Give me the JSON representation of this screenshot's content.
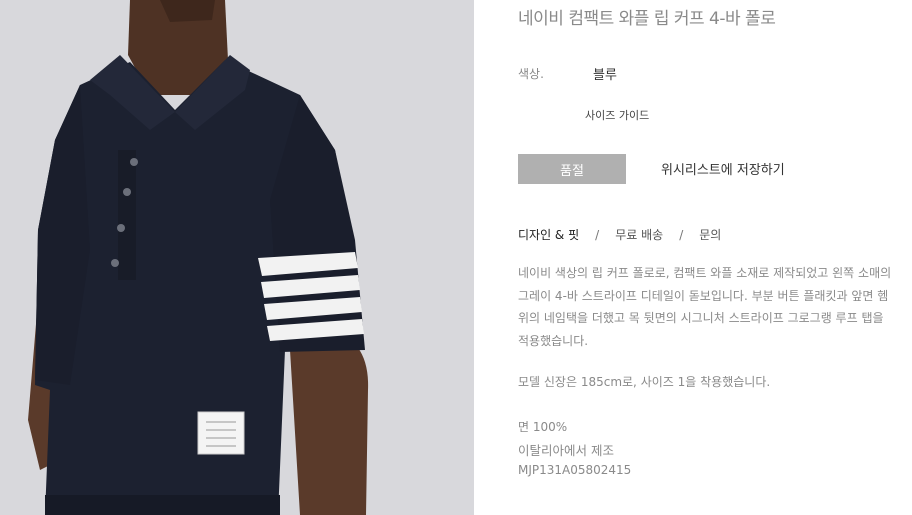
{
  "product": {
    "title": "네이비 컴팩트 와플 립 커프 4-바 폴로",
    "color_label": "색상.",
    "color_value": "블루",
    "size_guide_label": "사이즈 가이드",
    "soldout_label": "품절",
    "wishlist_label": "위시리스트에 저장하기"
  },
  "tabs": [
    {
      "label": "디자인 & 핏"
    },
    {
      "label": "무료 배송"
    },
    {
      "label": "문의"
    }
  ],
  "tab_separator": "/",
  "details": {
    "description": "네이비 색상의 립 커프 폴로로, 컴팩트 와플 소재로 제작되었고 왼쪽 소매의 그레이 4-바 스트라이프 디테일이 돋보입니다. 부분 버튼 플래킷과 앞면 헴 위의 네임택을 더했고 목 뒷면의 시그니처 스트라이프 그로그랭 루프 탭을 적용했습니다.",
    "model_info": "모델 신장은 185cm로, 사이즈 1을 착용했습니다.",
    "material": "면 100%",
    "origin": "이탈리아에서 제조",
    "sku": "MJP131A05802415"
  },
  "colors": {
    "background": "#ffffff",
    "photo_background": "#d8d8dc",
    "shirt": "#1c2130",
    "skin": "#5a3a2a",
    "button_disabled": "#b0b0b0",
    "muted_text": "#8a8a8a"
  }
}
